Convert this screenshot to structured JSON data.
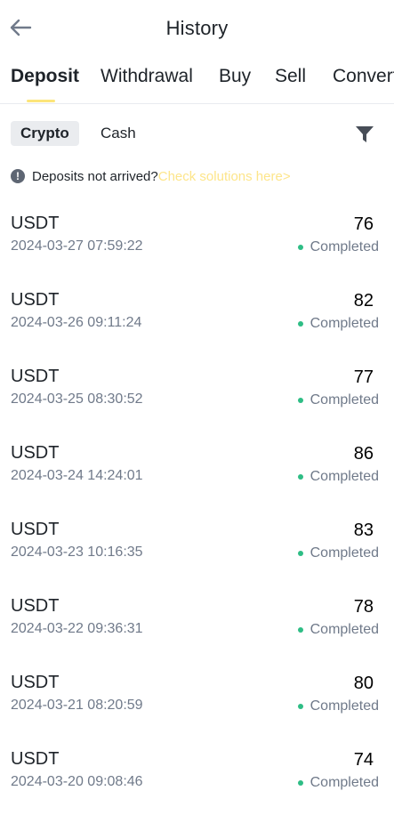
{
  "header": {
    "title": "History"
  },
  "tabs": [
    {
      "label": "Deposit",
      "active": true
    },
    {
      "label": "Withdrawal",
      "active": false
    },
    {
      "label": "Buy",
      "active": false
    },
    {
      "label": "Sell",
      "active": false
    },
    {
      "label": "Convert",
      "active": false
    }
  ],
  "subtabs": [
    {
      "label": "Crypto",
      "active": true
    },
    {
      "label": "Cash",
      "active": false
    }
  ],
  "notice": {
    "text": "Deposits not arrived?",
    "link": "Check solutions here>"
  },
  "colors": {
    "accent": "#fcd535",
    "status_completed": "#2ebd85",
    "muted_text": "#707a8a"
  },
  "icons": {
    "back": "arrow-left-icon",
    "filter": "funnel-icon",
    "info": "exclamation-circle-icon"
  },
  "records": [
    {
      "coin": "USDT",
      "datetime": "2024-03-27 07:59:22",
      "amount": "76",
      "status": "Completed"
    },
    {
      "coin": "USDT",
      "datetime": "2024-03-26 09:11:24",
      "amount": "82",
      "status": "Completed"
    },
    {
      "coin": "USDT",
      "datetime": "2024-03-25 08:30:52",
      "amount": "77",
      "status": "Completed"
    },
    {
      "coin": "USDT",
      "datetime": "2024-03-24 14:24:01",
      "amount": "86",
      "status": "Completed"
    },
    {
      "coin": "USDT",
      "datetime": "2024-03-23 10:16:35",
      "amount": "83",
      "status": "Completed"
    },
    {
      "coin": "USDT",
      "datetime": "2024-03-22 09:36:31",
      "amount": "78",
      "status": "Completed"
    },
    {
      "coin": "USDT",
      "datetime": "2024-03-21 08:20:59",
      "amount": "80",
      "status": "Completed"
    },
    {
      "coin": "USDT",
      "datetime": "2024-03-20 09:08:46",
      "amount": "74",
      "status": "Completed"
    }
  ]
}
